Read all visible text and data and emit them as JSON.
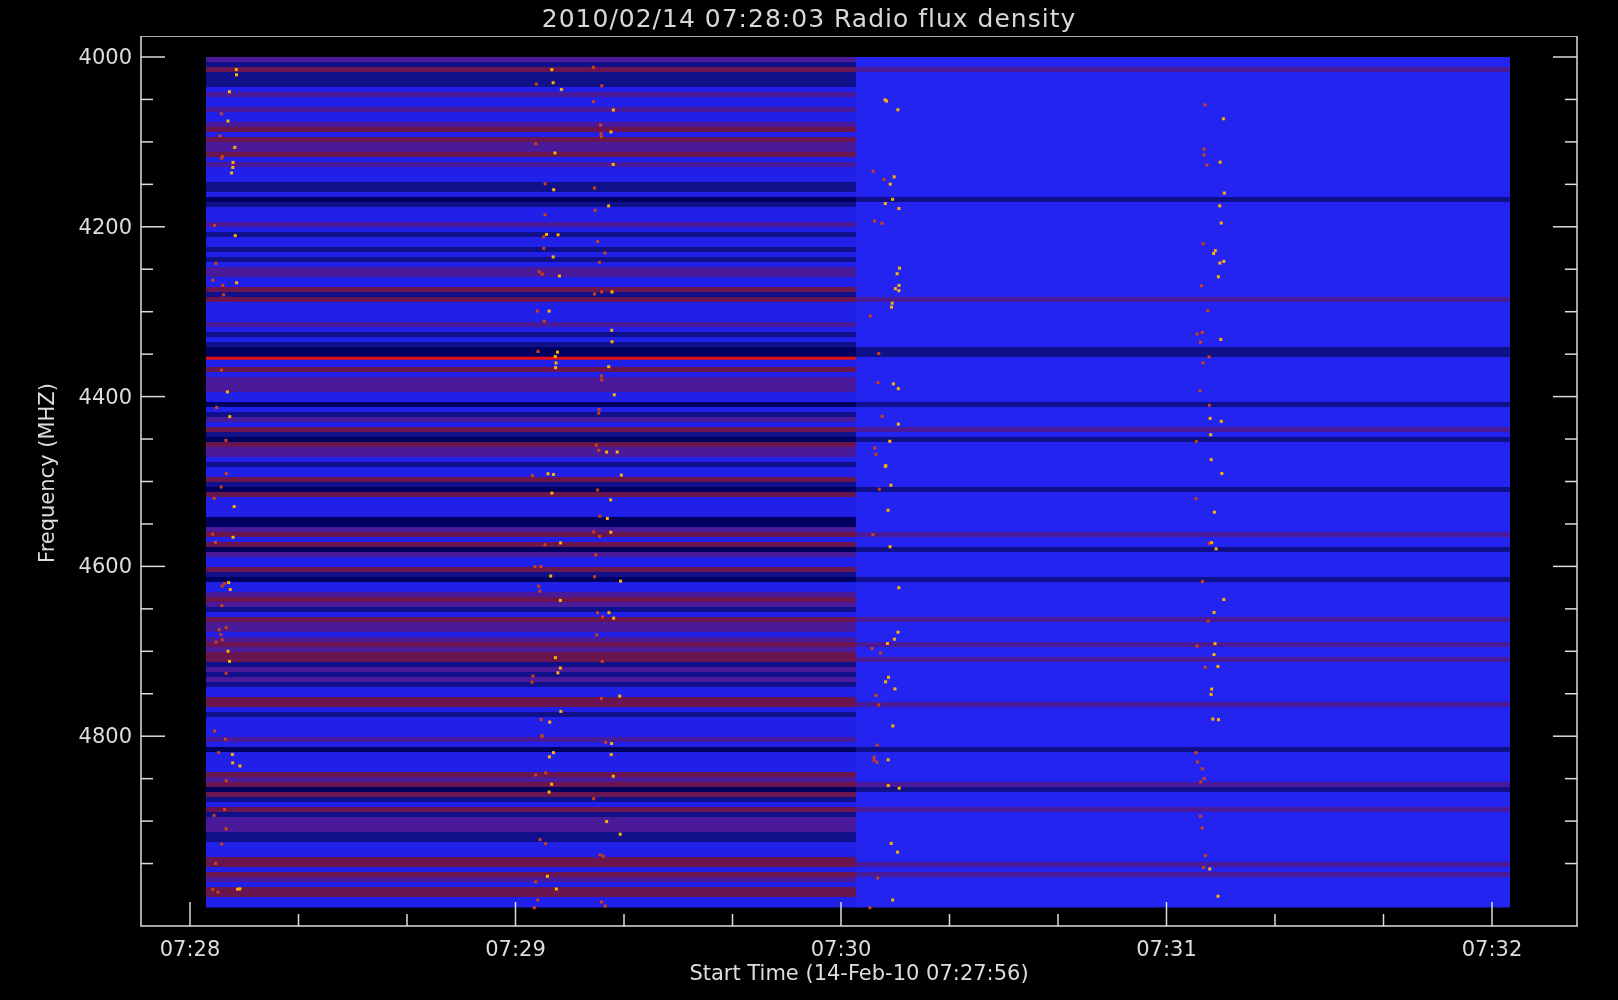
{
  "plot": {
    "title": "2010/02/14 07:28:03 Radio flux density",
    "ylabel": "Frequency (MHZ)",
    "xlabel": "Start Time (14-Feb-10 07:27:56)",
    "yticks": [
      "4000",
      "4200",
      "4400",
      "4600",
      "4800"
    ],
    "xticks": [
      "07:28",
      "07:29",
      "07:30",
      "07:31",
      "07:32"
    ]
  }
}
